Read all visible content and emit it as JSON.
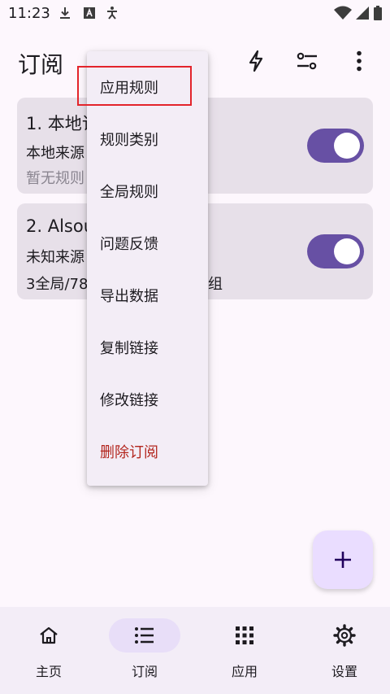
{
  "status_bar": {
    "time": "11:23",
    "left_icons": [
      "download-icon",
      "font-icon",
      "accessibility-icon"
    ],
    "right_icons": [
      "wifi-icon",
      "cellular-icon",
      "battery-icon"
    ]
  },
  "app_bar": {
    "title": "订阅",
    "actions": [
      "flash-icon",
      "filter-settings-icon",
      "more-vert-icon"
    ]
  },
  "cards": [
    {
      "title": "1. 本地订",
      "subtitle": "本地来源",
      "info": "暂无规则",
      "enabled": true
    },
    {
      "title": "2. Alsou",
      "subtitle": "未知来源",
      "info": "3全局/78",
      "info_tail": "组",
      "enabled": true
    }
  ],
  "menu": {
    "items": [
      {
        "label": "应用规则",
        "highlighted": true
      },
      {
        "label": "规则类别"
      },
      {
        "label": "全局规则"
      },
      {
        "label": "问题反馈"
      },
      {
        "label": "导出数据"
      },
      {
        "label": "复制链接"
      },
      {
        "label": "修改链接"
      },
      {
        "label": "删除订阅",
        "danger": true
      }
    ]
  },
  "fab": {
    "icon": "plus-icon"
  },
  "bottom_nav": [
    {
      "label": "主页",
      "icon": "home-icon",
      "active": false
    },
    {
      "label": "订阅",
      "icon": "list-icon",
      "active": true
    },
    {
      "label": "应用",
      "icon": "apps-grid-icon",
      "active": false
    },
    {
      "label": "设置",
      "icon": "gear-icon",
      "active": false
    }
  ],
  "colors": {
    "background": "#fdf7fd",
    "card": "#e7e0e9",
    "switch_track": "#6750a4",
    "menu_bg": "#f3edf6",
    "danger": "#b3261e",
    "highlight_box": "#e3242b",
    "fab": "#eaddff",
    "nav_active_pill": "#e8def8"
  }
}
